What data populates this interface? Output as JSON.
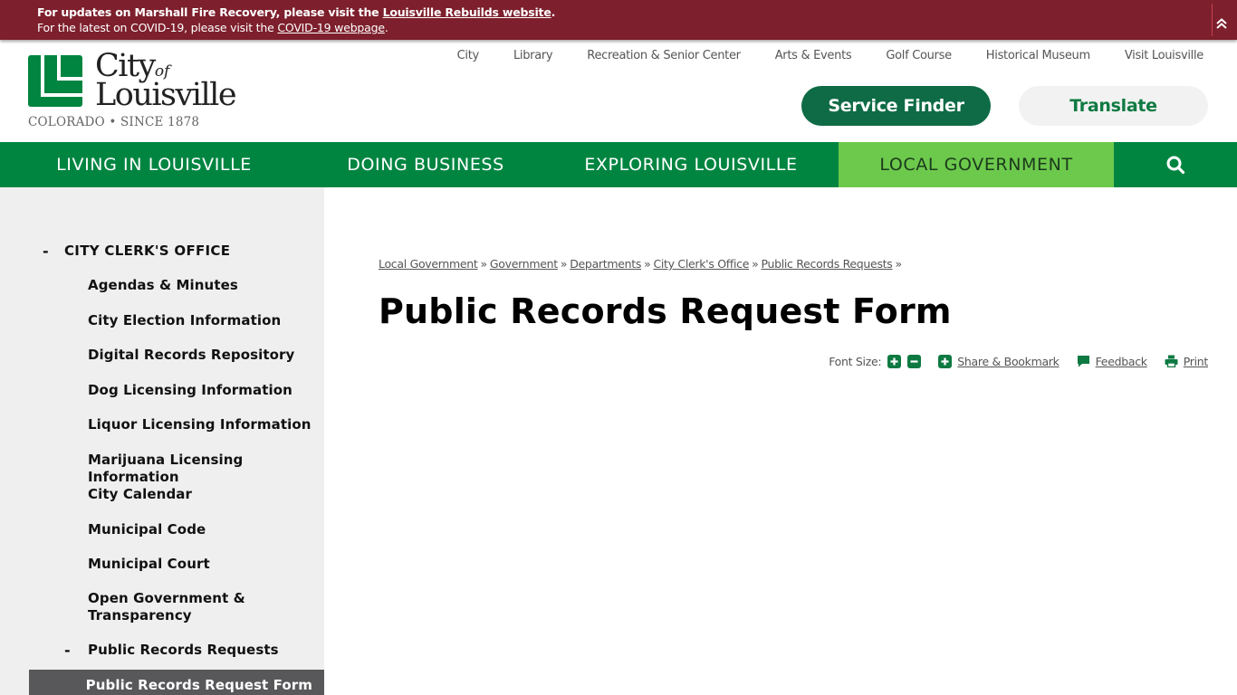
{
  "alert": {
    "line1_prefix": "For updates on Marshall Fire Recovery, please visit the ",
    "line1_link": "Louisville Rebuilds website",
    "line1_suffix": ".",
    "line2_prefix": "For the latest on COVID-19, please visit the ",
    "line2_link": "COVID-19 webpage",
    "line2_suffix": ".",
    "collapse_icon": "double-chevron-up-icon"
  },
  "logo": {
    "city": "City",
    "of": "of",
    "louisville": "Louisville",
    "subtitle": "COLORADO • SINCE 1878",
    "brand_color": "#008541"
  },
  "utility_nav": [
    "City",
    "Library",
    "Recreation & Senior Center",
    "Arts & Events",
    "Golf Course",
    "Historical Museum",
    "Visit Louisville"
  ],
  "buttons": {
    "service_finder": "Service Finder",
    "translate": "Translate"
  },
  "main_nav": {
    "items": [
      "LIVING IN LOUISVILLE",
      "DOING BUSINESS",
      "EXPLORING LOUISVILLE",
      "LOCAL GOVERNMENT"
    ],
    "active": "LOCAL GOVERNMENT",
    "search_icon": "search-icon",
    "colors": {
      "nav": "#008541",
      "active": "#6cc94c"
    }
  },
  "sidebar": {
    "section": "CITY CLERK'S OFFICE",
    "items": [
      "Agendas & Minutes",
      "City Election Information",
      "Digital Records Repository",
      "Dog Licensing Information",
      "Liquor Licensing Information",
      "Marijuana Licensing Information",
      "City Calendar",
      "Municipal Code",
      "Municipal Court",
      "Open Government & Transparency",
      "Public Records Requests"
    ],
    "open_government_line1": "Open Government &",
    "open_government_line2": "Transparency",
    "active_child": "Public Records Request Form"
  },
  "breadcrumb": [
    "Local Government",
    "Government",
    "Departments",
    "City Clerk's Office",
    "Public Records Requests"
  ],
  "breadcrumb_separator": "»",
  "page_title": "Public Records Request Form",
  "tools": {
    "font_size_label": "Font Size:",
    "increase": "+",
    "decrease": "−",
    "share": "Share & Bookmark",
    "feedback": "Feedback",
    "print": "Print"
  }
}
